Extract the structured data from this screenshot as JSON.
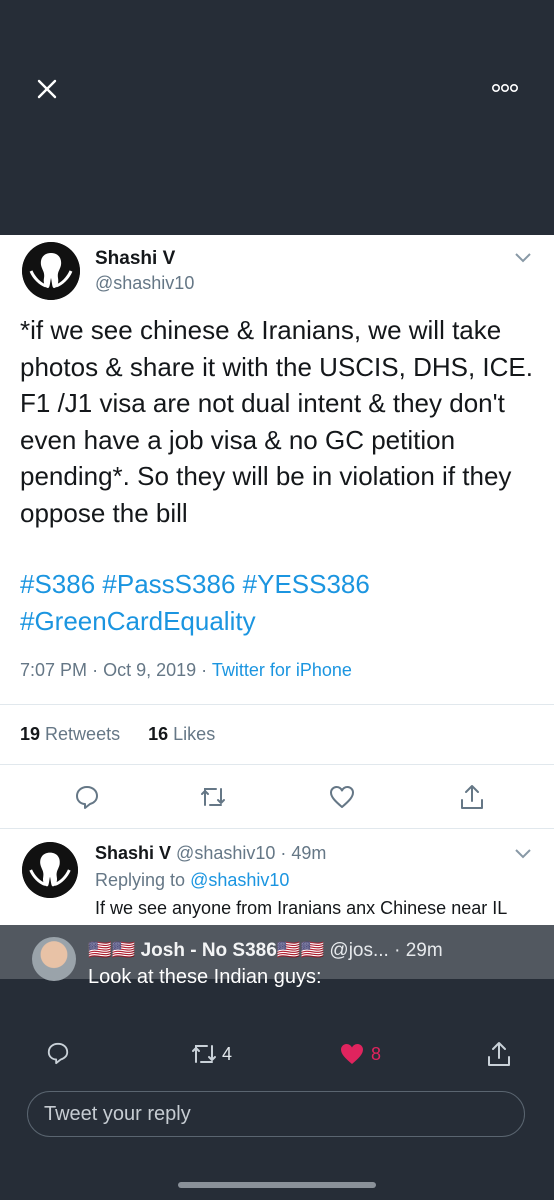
{
  "colors": {
    "dark_bg": "#262d37",
    "link": "#1b95e0",
    "text": "#14171a",
    "muted": "#657786",
    "like_red": "#e0245e"
  },
  "header": {
    "close_icon": "close-icon",
    "more_icon": "more-horizontal-icon"
  },
  "tweet": {
    "author_name": "Shashi V",
    "author_handle": "@shashiv10",
    "text": "*if we see chinese & Iranians, we will take photos & share it with the USCIS, DHS, ICE. F1 /J1 visa are not dual intent & they don't even have a job visa & no GC petition pending*. So they will be in violation if they oppose the bill",
    "hashtags": [
      "#S386",
      "#PassS386",
      "#YESS386",
      "#GreenCardEquality"
    ],
    "time": "7:07 PM",
    "date": "Oct 9, 2019",
    "source": "Twitter for iPhone",
    "retweets_count": "19",
    "retweets_label": "Retweets",
    "likes_count": "16",
    "likes_label": "Likes"
  },
  "reply": {
    "author_name": "Shashi V",
    "author_handle": "@shashiv10",
    "age": "49m",
    "replying_prefix": "Replying to",
    "replying_handle": "@shashiv10",
    "text": "If we see anyone from Iranians anx Chinese near IL"
  },
  "notification": {
    "author": "🇺🇸🇺🇸 Josh - No S386🇺🇸🇺🇸",
    "handle": "@jos...",
    "age": "· 29m",
    "text": "Look at these Indian guys:",
    "retweets": "4",
    "likes": "8"
  },
  "composer": {
    "placeholder": "Tweet your reply"
  }
}
